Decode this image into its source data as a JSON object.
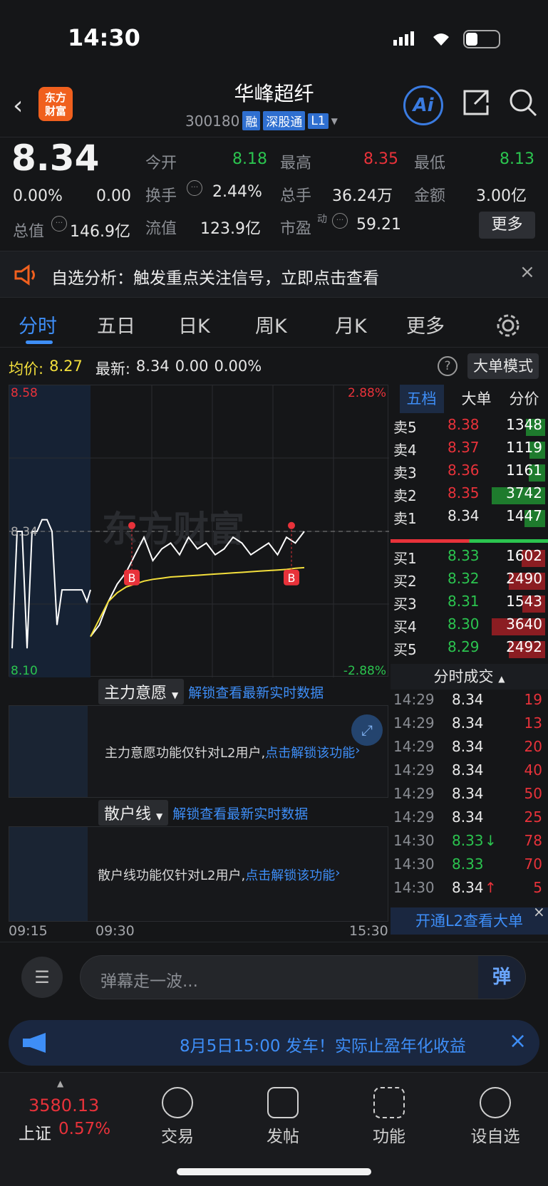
{
  "status": {
    "time": "14:30"
  },
  "header": {
    "logo_line1": "东方",
    "logo_line2": "财富",
    "title": "华峰超纤",
    "code": "300180",
    "tags": [
      "融",
      "深股通",
      "L1"
    ],
    "ai_label": "Ai"
  },
  "quote": {
    "price": "8.34",
    "change_pct": "0.00%",
    "change": "0.00",
    "open_label": "今开",
    "open": "8.18",
    "high_label": "最高",
    "high": "8.35",
    "low_label": "最低",
    "low": "8.13",
    "turnover_label": "换手",
    "turnover": "2.44%",
    "volume_label": "总手",
    "volume": "36.24万",
    "amount_label": "金额",
    "amount": "3.00亿",
    "mktcap_label": "总值",
    "mktcap": "146.9亿",
    "float_label": "流值",
    "float": "123.9亿",
    "pe_label": "市盈",
    "pe_sup": "动",
    "pe": "59.21",
    "more": "更多"
  },
  "notice": {
    "text": "自选分析：触发重点关注信号，立即点击查看"
  },
  "tabs": [
    "分时",
    "五日",
    "日K",
    "周K",
    "月K",
    "更多"
  ],
  "info": {
    "avg_label": "均价:",
    "avg": "8.27",
    "latest_label": "最新:",
    "latest": "8.34",
    "chg": "0.00",
    "pct": "0.00%",
    "mode_btn": "大单模式"
  },
  "chart_data": {
    "type": "line",
    "ylim": [
      8.1,
      8.58
    ],
    "y_ticks_left": [
      "8.58",
      "8.34",
      "8.10"
    ],
    "y_ticks_right": [
      "2.88%",
      "-2.88%"
    ],
    "x_labels": [
      "09:15",
      "09:30",
      "15:30"
    ],
    "series": [
      {
        "name": "价格",
        "color": "#ffffff",
        "values": [
          8.16,
          8.18,
          8.22,
          8.25,
          8.27,
          8.3,
          8.33,
          8.29,
          8.31,
          8.32,
          8.3,
          8.33,
          8.31,
          8.32,
          8.3,
          8.31,
          8.33,
          8.32,
          8.3,
          8.31,
          8.32,
          8.3,
          8.33,
          8.32,
          8.34
        ]
      },
      {
        "name": "均价",
        "color": "#f3df3c",
        "values": [
          8.16,
          8.19,
          8.22,
          8.235,
          8.245,
          8.25,
          8.255,
          8.258,
          8.26,
          8.262,
          8.263,
          8.264,
          8.265,
          8.266,
          8.267,
          8.268,
          8.269,
          8.27,
          8.271,
          8.272,
          8.273,
          8.274,
          8.275,
          8.277,
          8.278
        ]
      }
    ],
    "markers": [
      "B",
      "B"
    ],
    "watermark": "东方财富"
  },
  "orderbook": {
    "tabs": [
      "五档",
      "大单",
      "分价"
    ],
    "asks": [
      {
        "label": "卖5",
        "price": "8.38",
        "vol": "1348"
      },
      {
        "label": "卖4",
        "price": "8.37",
        "vol": "1119"
      },
      {
        "label": "卖3",
        "price": "8.36",
        "vol": "1161"
      },
      {
        "label": "卖2",
        "price": "8.35",
        "vol": "3742"
      },
      {
        "label": "卖1",
        "price": "8.34",
        "vol": "1447"
      }
    ],
    "bids": [
      {
        "label": "买1",
        "price": "8.33",
        "vol": "1602"
      },
      {
        "label": "买2",
        "price": "8.32",
        "vol": "2490"
      },
      {
        "label": "买3",
        "price": "8.31",
        "vol": "1543"
      },
      {
        "label": "买4",
        "price": "8.30",
        "vol": "3640"
      },
      {
        "label": "买5",
        "price": "8.29",
        "vol": "2492"
      }
    ],
    "trades_title": "分时成交",
    "trades": [
      {
        "t": "14:29",
        "p": "8.34",
        "v": "19",
        "arrow": ""
      },
      {
        "t": "14:29",
        "p": "8.34",
        "v": "13",
        "arrow": ""
      },
      {
        "t": "14:29",
        "p": "8.34",
        "v": "20",
        "arrow": ""
      },
      {
        "t": "14:29",
        "p": "8.34",
        "v": "40",
        "arrow": ""
      },
      {
        "t": "14:29",
        "p": "8.34",
        "v": "50",
        "arrow": ""
      },
      {
        "t": "14:29",
        "p": "8.34",
        "v": "25",
        "arrow": ""
      },
      {
        "t": "14:30",
        "p": "8.33",
        "v": "78",
        "arrow": "↓"
      },
      {
        "t": "14:30",
        "p": "8.33",
        "v": "70",
        "arrow": ""
      },
      {
        "t": "14:30",
        "p": "8.34",
        "v": "5",
        "arrow": "↑"
      }
    ],
    "l2_btn": "开通L2查看大单"
  },
  "panels": {
    "p1_title": "主力意愿",
    "p1_unlock": "解锁查看最新实时数据",
    "p1_msg": "主力意愿功能仅针对L2用户,",
    "p1_link": "点击解锁该功能",
    "p2_title": "散户线",
    "p2_unlock": "解锁查看最新实时数据",
    "p2_msg": "散户线功能仅针对L2用户,",
    "p2_link": "点击解锁该功能"
  },
  "comment": {
    "placeholder": "弹幕走一波...",
    "btn": "弹"
  },
  "ad": {
    "text": "8月5日15:00 发车！实际止盈年化收益"
  },
  "nav": {
    "index_value": "3580.13",
    "index_name": "上证",
    "index_pct": "0.57%",
    "items": [
      "交易",
      "发帖",
      "功能",
      "设自选"
    ]
  }
}
